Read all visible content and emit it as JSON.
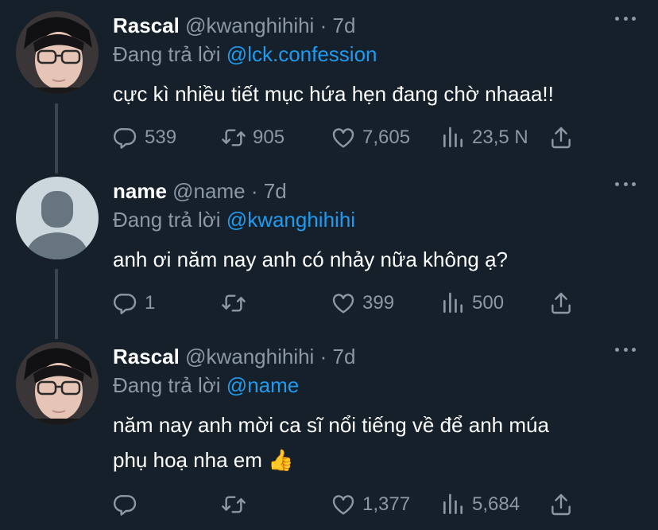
{
  "tweets": [
    {
      "name": "Rascal",
      "handle": "@kwanghihihi",
      "separator": "·",
      "time": "7d",
      "reply_prefix": "Đang trả lời",
      "reply_to": "@lck.confession",
      "text": "cực kì nhiều tiết mục hứa hẹn đang chờ nhaaa!!",
      "replies": "539",
      "retweets": "905",
      "likes": "7,605",
      "views": "23,5 N"
    },
    {
      "name": "name",
      "handle": "@name",
      "separator": "·",
      "time": "7d",
      "reply_prefix": "Đang trả lời",
      "reply_to": "@kwanghihihi",
      "text": "anh ơi năm nay anh có nhảy nữa không ạ?",
      "replies": "1",
      "retweets": "",
      "likes": "399",
      "views": "500"
    },
    {
      "name": "Rascal",
      "handle": "@kwanghihihi",
      "separator": "·",
      "time": "7d",
      "reply_prefix": "Đang trả lời",
      "reply_to": "@name",
      "text_line1": "năm nay anh mời ca sĩ nổi tiếng về để anh múa",
      "text_line2": "phụ hoạ nha em 👍",
      "replies": "",
      "retweets": "",
      "likes": "1,377",
      "views": "5,684"
    }
  ],
  "colors": {
    "background": "#15202b",
    "secondary_text": "#8b98a5",
    "link": "#1d9bf0",
    "thread_line": "#38444d"
  },
  "icons": [
    "reply-icon",
    "retweet-icon",
    "like-icon",
    "views-icon",
    "share-icon",
    "more-icon"
  ]
}
